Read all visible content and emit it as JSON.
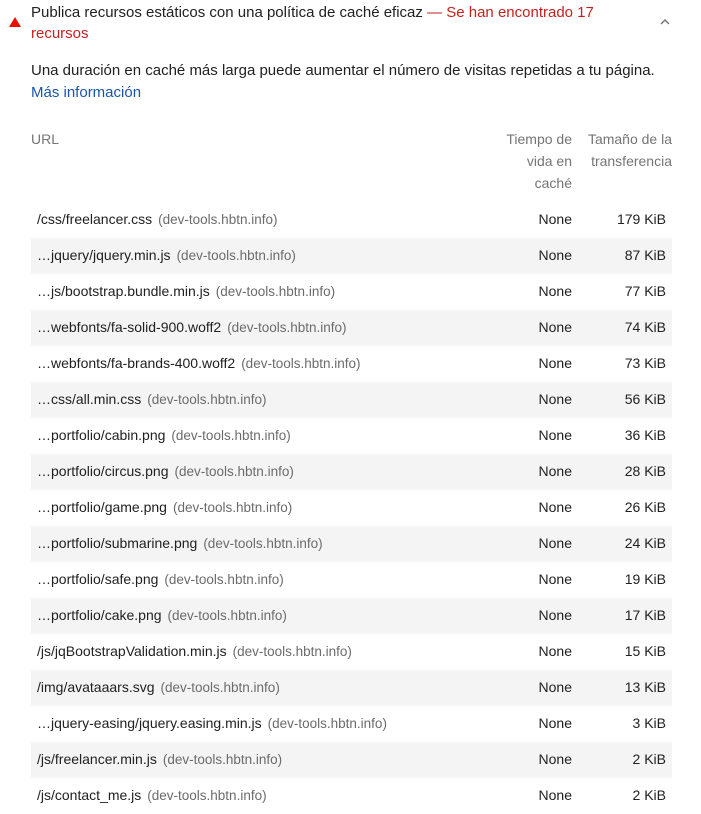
{
  "audit": {
    "title": "Publica recursos estáticos con una política de caché eficaz",
    "separator": "— ",
    "found_text": "Se han encontrado 17 recursos",
    "description": "Una duración en caché más larga puede aumentar el número de visitas repetidas a tu página.",
    "learn_more": "Más información",
    "status_color": "#eb0f00",
    "icons": {
      "status": "warning-triangle-icon",
      "toggle": "chevron-up-icon"
    }
  },
  "table": {
    "headers": {
      "url": "URL",
      "ttl": "Tiempo de vida en caché",
      "size": "Tamaño de la transferencia"
    },
    "rows": [
      {
        "path": "/css/freelancer.css",
        "host": "(dev-tools.hbtn.info)",
        "ttl": "None",
        "size": "179 KiB"
      },
      {
        "path": "…jquery/jquery.min.js",
        "host": "(dev-tools.hbtn.info)",
        "ttl": "None",
        "size": "87 KiB"
      },
      {
        "path": "…js/bootstrap.bundle.min.js",
        "host": "(dev-tools.hbtn.info)",
        "ttl": "None",
        "size": "77 KiB"
      },
      {
        "path": "…webfonts/fa-solid-900.woff2",
        "host": "(dev-tools.hbtn.info)",
        "ttl": "None",
        "size": "74 KiB"
      },
      {
        "path": "…webfonts/fa-brands-400.woff2",
        "host": "(dev-tools.hbtn.info)",
        "ttl": "None",
        "size": "73 KiB"
      },
      {
        "path": "…css/all.min.css",
        "host": "(dev-tools.hbtn.info)",
        "ttl": "None",
        "size": "56 KiB"
      },
      {
        "path": "…portfolio/cabin.png",
        "host": "(dev-tools.hbtn.info)",
        "ttl": "None",
        "size": "36 KiB"
      },
      {
        "path": "…portfolio/circus.png",
        "host": "(dev-tools.hbtn.info)",
        "ttl": "None",
        "size": "28 KiB"
      },
      {
        "path": "…portfolio/game.png",
        "host": "(dev-tools.hbtn.info)",
        "ttl": "None",
        "size": "26 KiB"
      },
      {
        "path": "…portfolio/submarine.png",
        "host": "(dev-tools.hbtn.info)",
        "ttl": "None",
        "size": "24 KiB"
      },
      {
        "path": "…portfolio/safe.png",
        "host": "(dev-tools.hbtn.info)",
        "ttl": "None",
        "size": "19 KiB"
      },
      {
        "path": "…portfolio/cake.png",
        "host": "(dev-tools.hbtn.info)",
        "ttl": "None",
        "size": "17 KiB"
      },
      {
        "path": "/js/jqBootstrapValidation.min.js",
        "host": "(dev-tools.hbtn.info)",
        "ttl": "None",
        "size": "15 KiB"
      },
      {
        "path": "/img/avataaars.svg",
        "host": "(dev-tools.hbtn.info)",
        "ttl": "None",
        "size": "13 KiB"
      },
      {
        "path": "…jquery-easing/jquery.easing.min.js",
        "host": "(dev-tools.hbtn.info)",
        "ttl": "None",
        "size": "3 KiB"
      },
      {
        "path": "/js/freelancer.min.js",
        "host": "(dev-tools.hbtn.info)",
        "ttl": "None",
        "size": "2 KiB"
      },
      {
        "path": "/js/contact_me.js",
        "host": "(dev-tools.hbtn.info)",
        "ttl": "None",
        "size": "2 KiB"
      }
    ]
  }
}
